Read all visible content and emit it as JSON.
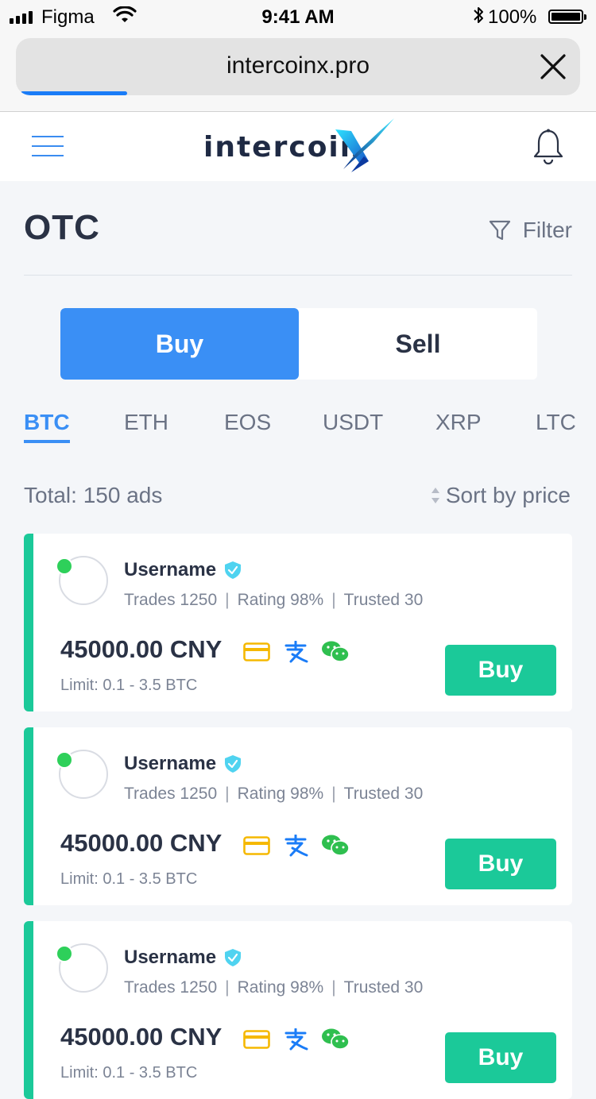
{
  "status_bar": {
    "carrier": "Figma",
    "time": "9:41 AM",
    "battery": "100%"
  },
  "browser": {
    "url": "intercoinx.pro"
  },
  "header": {
    "logo_text": "intercoin",
    "logo_accent": "X"
  },
  "page": {
    "title": "OTC",
    "filter_label": "Filter"
  },
  "segment": {
    "buy_label": "Buy",
    "sell_label": "Sell",
    "active": "Buy"
  },
  "coins": [
    "BTC",
    "ETH",
    "EOS",
    "USDT",
    "XRP",
    "LTC"
  ],
  "list": {
    "total_label": "Total: 150 ads",
    "sort_label": "Sort by price"
  },
  "ads": [
    {
      "username": "Username",
      "trades": "Trades 1250",
      "rating": "Rating 98%",
      "trusted": "Trusted 30",
      "price": "45000.00 CNY",
      "limit": "Limit: 0.1 - 3.5 BTC",
      "action": "Buy",
      "payment_icons": [
        "bank-card-icon",
        "alipay-icon",
        "wechat-icon"
      ]
    },
    {
      "username": "Username",
      "trades": "Trades 1250",
      "rating": "Rating 98%",
      "trusted": "Trusted 30",
      "price": "45000.00 CNY",
      "limit": "Limit: 0.1 - 3.5 BTC",
      "action": "Buy",
      "payment_icons": [
        "bank-card-icon",
        "alipay-icon",
        "wechat-icon"
      ]
    },
    {
      "username": "Username",
      "trades": "Trades 1250",
      "rating": "Rating 98%",
      "trusted": "Trusted 30",
      "price": "45000.00 CNY",
      "limit": "Limit: 0.1 - 3.5 BTC",
      "action": "Buy",
      "payment_icons": [
        "bank-card-icon",
        "alipay-icon",
        "wechat-icon"
      ]
    }
  ],
  "colors": {
    "accent_blue": "#3a8ff5",
    "accent_green": "#1bc999",
    "online_dot": "#2ed05a",
    "text_dark": "#2a3245",
    "text_muted": "#7c8495",
    "card_icon": "#f5b800",
    "alipay": "#1a7cf7",
    "wechat": "#2fbf4f"
  }
}
